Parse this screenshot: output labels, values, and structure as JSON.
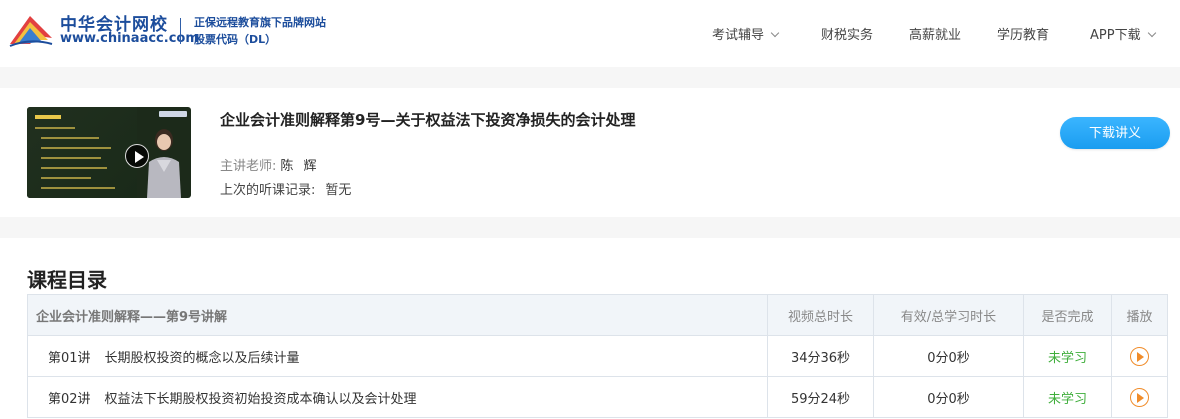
{
  "header": {
    "brand_name": "中华会计网校",
    "brand_url": "www.chinaacc.com",
    "tagline_1": "正保远程教育旗下品牌网站",
    "tagline_2": "股票代码（DL）",
    "nav": [
      {
        "label": "考试辅导",
        "has_dropdown": true
      },
      {
        "label": "财税实务",
        "has_dropdown": false
      },
      {
        "label": "高薪就业",
        "has_dropdown": false
      },
      {
        "label": "学历教育",
        "has_dropdown": false
      },
      {
        "label": "APP下载",
        "has_dropdown": true
      }
    ]
  },
  "course": {
    "title": "企业会计准则解释第9号—关于权益法下投资净损失的会计处理",
    "teacher_label": "主讲老师:",
    "teacher_name": "陈 辉",
    "last_record_label": "上次的听课记录:",
    "last_record_value": "暂无",
    "download_label": "下载讲义",
    "thumbnail_icon": "video-thumbnail",
    "play_icon": "play-icon"
  },
  "catalog": {
    "heading": "课程目录",
    "columns": {
      "name": "企业会计准则解释——第9号讲解",
      "video_duration": "视频总时长",
      "study_time": "有效/总学习时长",
      "completed": "是否完成",
      "play": "播放"
    },
    "rows": [
      {
        "num": "第01讲",
        "title": "长期股权投资的概念以及后续计量",
        "duration": "34分36秒",
        "study": "0分0秒",
        "status": "未学习"
      },
      {
        "num": "第02讲",
        "title": "权益法下长期股权投资初始投资成本确认以及会计处理",
        "duration": "59分24秒",
        "study": "0分0秒",
        "status": "未学习"
      }
    ]
  },
  "colors": {
    "brand_blue": "#1c4d9c",
    "button_blue": "#1a9df0",
    "status_green": "#3fae3b",
    "play_orange": "#f08c2a"
  }
}
